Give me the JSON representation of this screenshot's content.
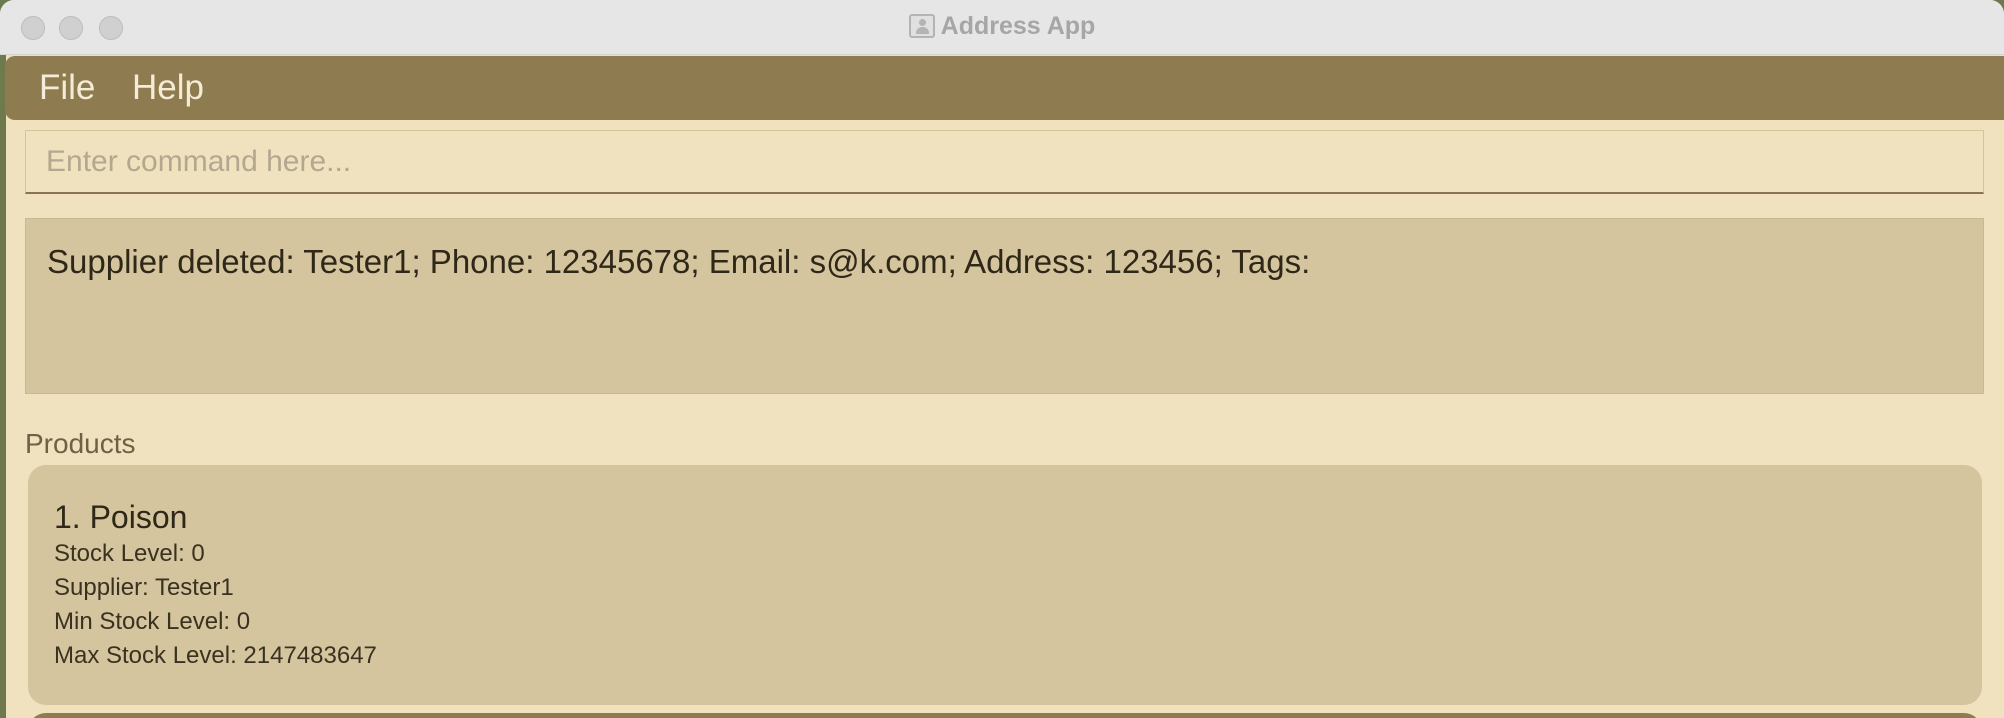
{
  "window": {
    "title": "Address App",
    "accent_color": "#8e7b4f",
    "background_color": "#f0e2bf",
    "panel_color": "#d4c59e"
  },
  "menu": {
    "file_label": "File",
    "help_label": "Help"
  },
  "command": {
    "placeholder": "Enter command here...",
    "value": ""
  },
  "result": {
    "text": "Supplier deleted: Tester1; Phone: 12345678; Email: s@k.com; Address: 123456; Tags:"
  },
  "products": {
    "heading": "Products",
    "items": [
      {
        "title": "1. Poison",
        "stock_level": "Stock Level: 0",
        "supplier": "Supplier: Tester1",
        "min_stock_level": "Min Stock Level: 0",
        "max_stock_level": "Max Stock Level: 2147483647"
      }
    ]
  }
}
